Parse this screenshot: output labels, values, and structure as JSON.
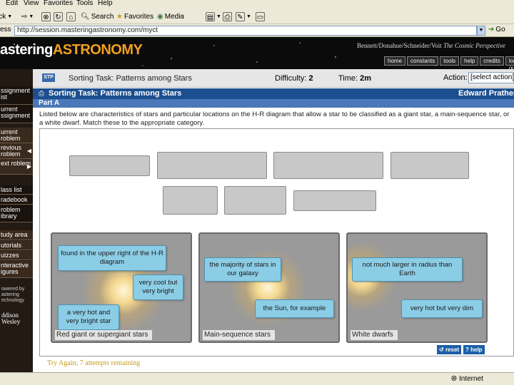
{
  "browser": {
    "menu": [
      "Edit",
      "View",
      "Favorites",
      "Tools",
      "Help"
    ],
    "toolbar": {
      "back_label": "Back",
      "search_label": "Search",
      "favorites_label": "Favorites",
      "media_label": "Media"
    },
    "address_label": "ess",
    "address_url": "http://session.masteringastronomy.com/myct",
    "go_label": "Go",
    "status_zone": "Internet"
  },
  "header": {
    "logo_white": "astering",
    "logo_orange": "ASTRONOMY",
    "authors": "Bennett/Donahue/Schneider/Voit",
    "book_title": "The Cosmic Perspective",
    "nav": [
      "home",
      "constants",
      "tools",
      "help",
      "credits",
      "log out"
    ]
  },
  "sidebar": {
    "items": [
      "ssignment ist",
      "urrent ssignment",
      "urrent roblem",
      "revious roblem",
      "ext roblem",
      "lass list",
      "radebook",
      "roblem ibrary",
      "tudy area",
      "utorials",
      "uizzes",
      "nteractive igures"
    ],
    "powered": "owered by astering echnology",
    "publisher": "ddison Wesley"
  },
  "infobar": {
    "stp": "STP",
    "task_name": "Sorting Task: Patterns among Stars",
    "difficulty_label": "Difficulty:",
    "difficulty_value": "2",
    "time_label": "Time:",
    "time_value": "2m",
    "action_label": "Action:",
    "action_value": "[select action]"
  },
  "title": {
    "text": "Sorting Task: Patterns among Stars",
    "user": "Edward Prather",
    "part": "Part A"
  },
  "instructions": "Listed below are characteristics of stars and particular locations on the H-R diagram that allow a star to be classified as a giant star, a main-sequence star, or a white dwarf. Match these to the appropriate category.",
  "bins": [
    {
      "label": "Red giant or supergiant stars",
      "cards": [
        "found in the upper right of the H-R diagram",
        "very cool but very bright",
        "a very hot and very bright star"
      ]
    },
    {
      "label": "Main-sequence stars",
      "cards": [
        "the majority of stars in our galaxy",
        "the Sun, for example"
      ]
    },
    {
      "label": "White dwarfs",
      "cards": [
        "not much larger in radius than Earth",
        "very hot but very dim"
      ]
    }
  ],
  "buttons": {
    "reset": "reset",
    "help": "help"
  },
  "feedback": "Try Again; 7 attempts remaining",
  "colors": {
    "title_bar": "#1c4f8f",
    "card": "#8ccde6",
    "logo_accent": "#f0a020",
    "feedback": "#c79a1a"
  }
}
